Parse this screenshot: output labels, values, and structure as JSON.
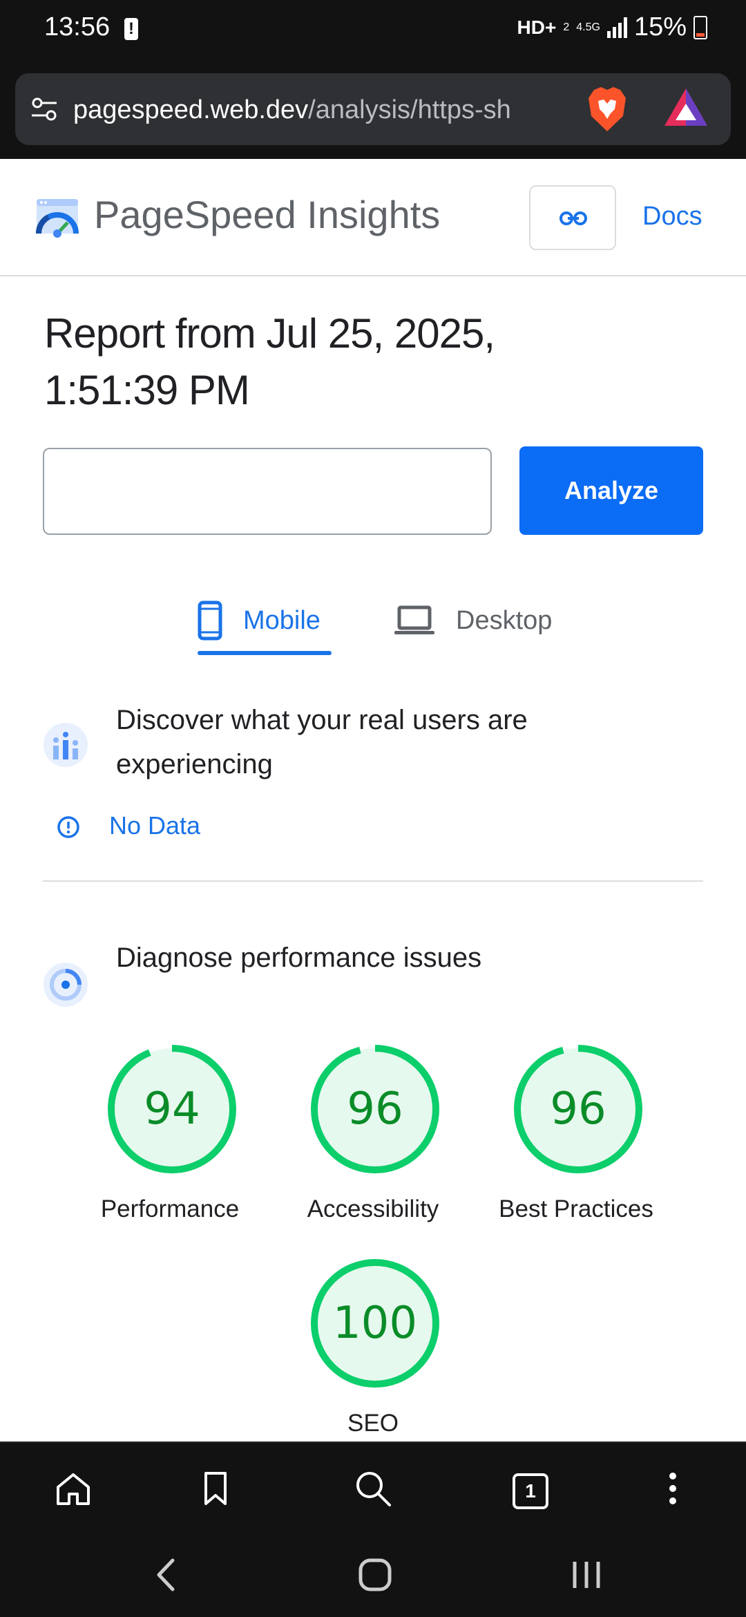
{
  "status_bar": {
    "time": "13:56",
    "network_label": "HD+",
    "network_sub": "2",
    "network_gen": "4.5G",
    "battery_percent": "15%"
  },
  "browser": {
    "url_host": "pagespeed.web.dev",
    "url_path": "/analysis/https-sh",
    "tab_count": "1"
  },
  "header": {
    "app_title": "PageSpeed Insights",
    "docs_label": "Docs"
  },
  "report": {
    "title": "Report from Jul 25, 2025, 1:51:39 PM"
  },
  "analyze_form": {
    "input_value": "",
    "button_label": "Analyze"
  },
  "device_tabs": [
    {
      "label": "Mobile",
      "selected": true
    },
    {
      "label": "Desktop",
      "selected": false
    }
  ],
  "crux": {
    "heading": "Discover what your real users are experiencing",
    "no_data_label": "No Data"
  },
  "diagnose": {
    "heading": "Diagnose performance issues",
    "scores": [
      {
        "label": "Performance",
        "value": 94
      },
      {
        "label": "Accessibility",
        "value": 96
      },
      {
        "label": "Best Practices",
        "value": 96
      },
      {
        "label": "SEO",
        "value": 100
      }
    ]
  },
  "colors": {
    "accent_blue": "#1a73e8",
    "score_good_stroke": "#0cce6b",
    "score_good_fill": "#e6f9ee",
    "score_good_text": "#0a8c28"
  }
}
